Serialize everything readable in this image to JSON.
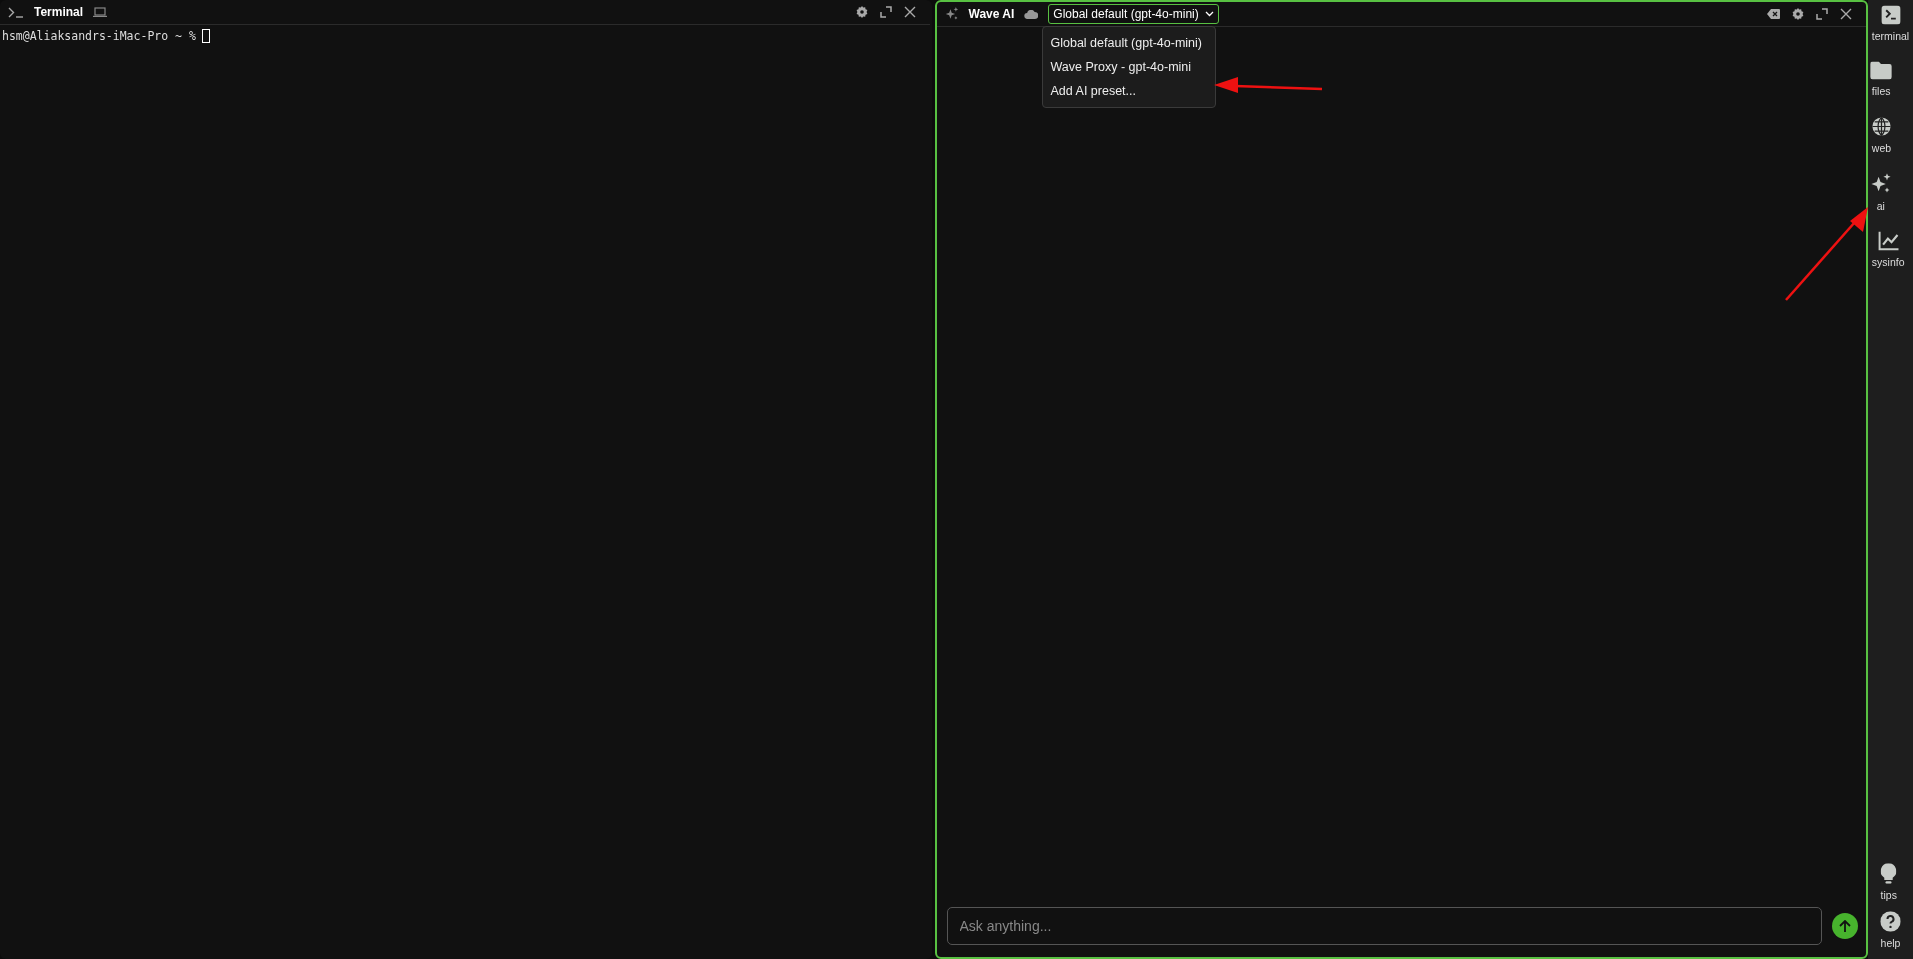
{
  "terminal_pane": {
    "title": "Terminal",
    "focused": false,
    "prompt": "hsm@Aliaksandrs-iMac-Pro ~ %"
  },
  "ai_pane": {
    "title": "Wave AI",
    "focused": true,
    "preset_select": {
      "value": "Global default (gpt-4o-mini)",
      "expanded": true,
      "options": [
        {
          "label": "Global default (gpt-4o-mini)"
        },
        {
          "label": "Wave Proxy - gpt-4o-mini"
        },
        {
          "label": "Add AI preset..."
        }
      ]
    },
    "input": {
      "placeholder": "Ask anything..."
    }
  },
  "sidebar": {
    "items": [
      {
        "kind": "terminal",
        "label": "terminal"
      },
      {
        "kind": "files",
        "label": "files"
      },
      {
        "kind": "web",
        "label": "web"
      },
      {
        "kind": "ai",
        "label": "ai"
      },
      {
        "kind": "sysinfo",
        "label": "sysinfo"
      }
    ],
    "bottom_items": [
      {
        "kind": "tips",
        "label": "tips"
      },
      {
        "kind": "help",
        "label": "help"
      }
    ]
  }
}
